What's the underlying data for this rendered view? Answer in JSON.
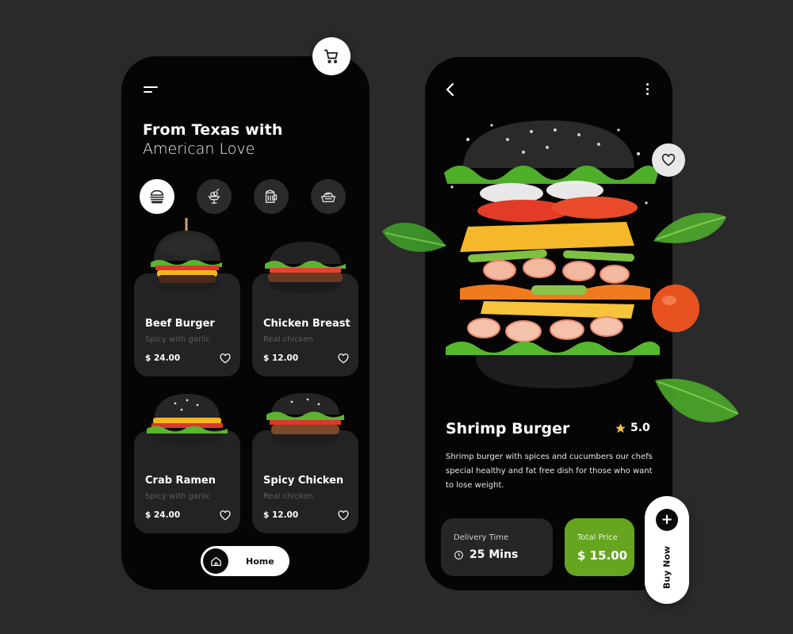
{
  "left_screen": {
    "headline_line1": "From Texas with",
    "headline_line2": "American Love",
    "categories": [
      {
        "icon": "burger-icon",
        "active": true
      },
      {
        "icon": "ice-cream-icon",
        "active": false
      },
      {
        "icon": "beer-icon",
        "active": false
      },
      {
        "icon": "bread-basket-icon",
        "active": false
      }
    ],
    "products": [
      {
        "name": "Beef Burger",
        "desc": "Spicy with garlic",
        "price": "$ 24.00"
      },
      {
        "name": "Chicken Breast",
        "desc": "Real chicken",
        "price": "$ 12.00"
      },
      {
        "name": "Crab Ramen",
        "desc": "Spicy with garlic",
        "price": "$ 24.00"
      },
      {
        "name": "Spicy Chicken",
        "desc": "Real chicken",
        "price": "$ 12.00"
      }
    ],
    "nav": {
      "home_label": "Home"
    }
  },
  "right_screen": {
    "title": "Shrimp Burger",
    "rating": "5.0",
    "description": "Shrimp burger with spices and cucumbers our chefs special healthy and fat free dish for those who want to lose weight.",
    "delivery_label": "Delivery Time",
    "delivery_value": "25 Mins",
    "price_label": "Total Price",
    "price_value": "$ 15.00",
    "buy_label": "Buy Now"
  },
  "colors": {
    "background": "#2a2a2a",
    "phone": "#050505",
    "card": "#232323",
    "accent_green": "#66a51f",
    "star": "#f2c14e"
  }
}
